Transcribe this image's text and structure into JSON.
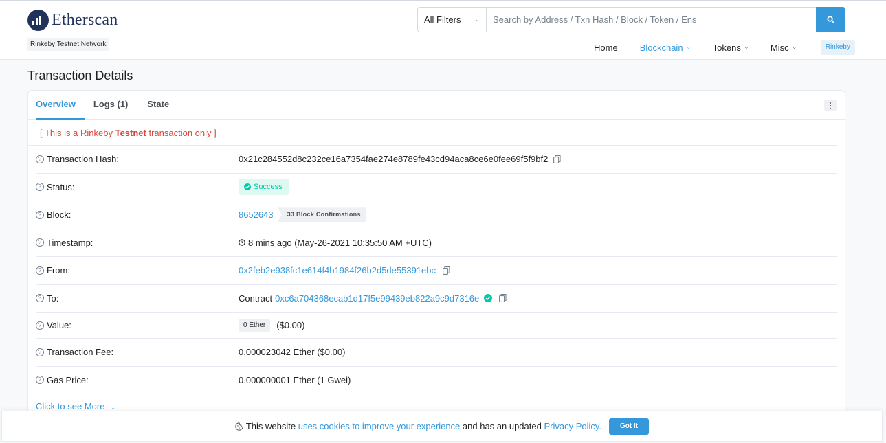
{
  "header": {
    "logo_text": "Etherscan",
    "network_badge": "Rinkeby Testnet Network",
    "search": {
      "filter_label": "All Filters",
      "placeholder": "Search by Address / Txn Hash / Block / Token / Ens"
    },
    "nav": [
      {
        "label": "Home"
      },
      {
        "label": "Blockchain"
      },
      {
        "label": "Tokens"
      },
      {
        "label": "Misc"
      }
    ],
    "network_pill": "Rinkeby"
  },
  "page_title": "Transaction Details",
  "tabs": [
    {
      "label": "Overview"
    },
    {
      "label": "Logs (1)"
    },
    {
      "label": "State"
    }
  ],
  "notice": {
    "prefix": "[ This is a Rinkeby ",
    "bold": "Testnet",
    "suffix": " transaction only ]"
  },
  "details": {
    "tx_hash": {
      "label": "Transaction Hash:",
      "value": "0x21c284552d8c232ce16a7354fae274e8789fe43cd94aca8ce6e0fee69f5f9bf2"
    },
    "status": {
      "label": "Status:",
      "value": "Success"
    },
    "block": {
      "label": "Block:",
      "value": "8652643",
      "confirmations": "33 Block Confirmations"
    },
    "timestamp": {
      "label": "Timestamp:",
      "value": "8 mins ago (May-26-2021 10:35:50 AM +UTC)"
    },
    "from": {
      "label": "From:",
      "value": "0x2feb2e938fc1e614f4b1984f26b2d5de55391ebc"
    },
    "to": {
      "label": "To:",
      "prefix": "Contract",
      "value": "0xc6a704368ecab1d17f5e99439eb822a9c9d7316e"
    },
    "value": {
      "label": "Value:",
      "badge": "0 Ether",
      "usd": "($0.00)"
    },
    "fee": {
      "label": "Transaction Fee:",
      "value": "0.000023042 Ether ($0.00)"
    },
    "gas": {
      "label": "Gas Price:",
      "value": "0.000000001 Ether (1 Gwei)"
    }
  },
  "see_more": "Click to see More",
  "cookie": {
    "text1": "This website",
    "link1": "uses cookies to improve your experience",
    "text2": "and has an updated",
    "link2": "Privacy Policy.",
    "button": "Got It"
  },
  "colors": {
    "accent": "#3498db",
    "success": "#00c9a7",
    "danger": "#de4437",
    "brand": "#21325b"
  }
}
